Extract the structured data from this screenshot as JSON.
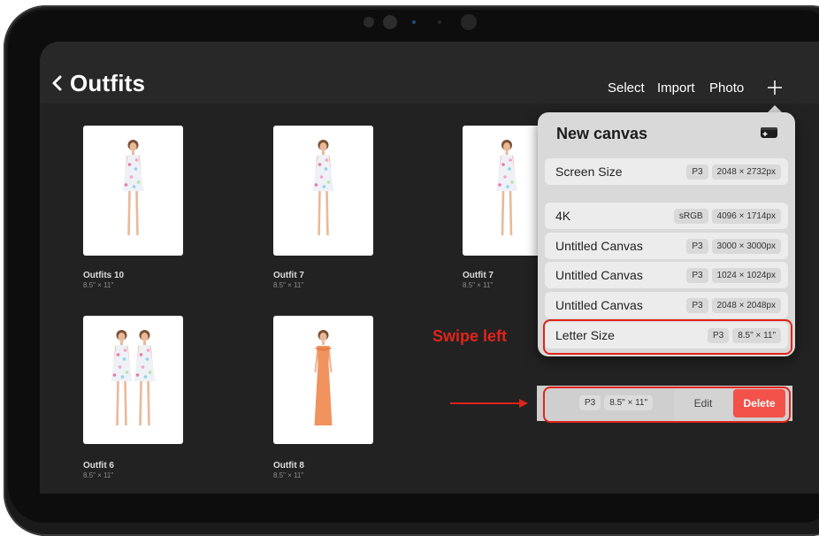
{
  "nav": {
    "back_label": "Outfits",
    "actions": [
      "Select",
      "Import",
      "Photo"
    ],
    "add_icon": "plus-icon"
  },
  "gallery": {
    "items": [
      {
        "title": "Outfits 10",
        "size": "8.5\" × 11\"",
        "figures": 1,
        "dress": "floral mini"
      },
      {
        "title": "Outfit 7",
        "size": "8.5\" × 11\"",
        "figures": 1,
        "dress": "floral mini"
      },
      {
        "title": "Outfit 7",
        "size": "8.5\" × 11\"",
        "figures": 1,
        "dress": "floral mini"
      },
      {
        "title": "Outfit 6",
        "size": "8.5\" × 11\"",
        "figures": 2,
        "dress": "floral mini"
      },
      {
        "title": "Outfit 8",
        "size": "8.5\" × 11\"",
        "figures": 1,
        "dress": "orange gown"
      }
    ]
  },
  "new_canvas": {
    "title": "New canvas",
    "icon": "new-canvas-icon",
    "screen_size": {
      "label": "Screen Size",
      "profile": "P3",
      "dims": "2048 × 2732px"
    },
    "presets": [
      {
        "label": "4K",
        "profile": "sRGB",
        "dims": "4096 × 1714px"
      },
      {
        "label": "Untitled Canvas",
        "profile": "P3",
        "dims": "3000 × 3000px"
      },
      {
        "label": "Untitled Canvas",
        "profile": "P3",
        "dims": "1024 × 1024px"
      },
      {
        "label": "Untitled Canvas",
        "profile": "P3",
        "dims": "2048 × 2048px"
      },
      {
        "label": "Letter Size",
        "profile": "P3",
        "dims": "8.5\" × 11\""
      }
    ]
  },
  "swiped_row": {
    "profile": "P3",
    "dims": "8.5\" × 11\"",
    "edit_label": "Edit",
    "delete_label": "Delete"
  },
  "annotation": {
    "text": "Swipe left",
    "color": "#e0241b"
  },
  "colors": {
    "accent_red": "#e0241b",
    "delete": "#f2524a",
    "screen_bg": "#222222",
    "popover_bg": "#d9d9d9"
  }
}
